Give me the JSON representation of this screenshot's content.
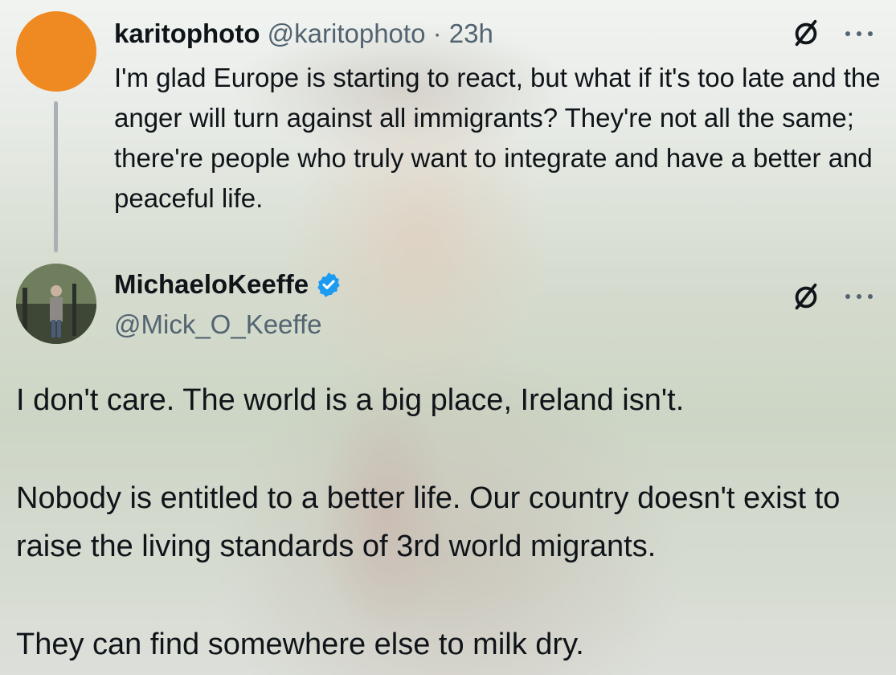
{
  "tweets": [
    {
      "author_name": "karitophoto",
      "author_handle": "@karitophoto",
      "separator": "·",
      "time": "23h",
      "text": "I'm glad Europe is starting to react, but what if it's too late and the anger will turn against all immigrants? They're not all the same; there're people who truly want to integrate and have a better and peaceful life.",
      "avatar_color": "#ef8a22"
    },
    {
      "author_name": "MichaeloKeeffe",
      "author_handle": "@Mick_O_Keeffe",
      "verified": true,
      "paragraphs": [
        "I don't care. The world is a big place, Ireland isn't.",
        "Nobody is entitled to a better life. Our country doesn't exist to raise the living standards of 3rd world migrants.",
        "They can find somewhere else to milk dry."
      ]
    }
  ],
  "icons": {
    "grok": "grok-slash-icon",
    "more": "more-horizontal-icon",
    "verified": "verified-badge-icon"
  },
  "colors": {
    "verified_blue": "#1d9bf0",
    "secondary_text": "#536471",
    "primary_text": "#0f1419"
  }
}
